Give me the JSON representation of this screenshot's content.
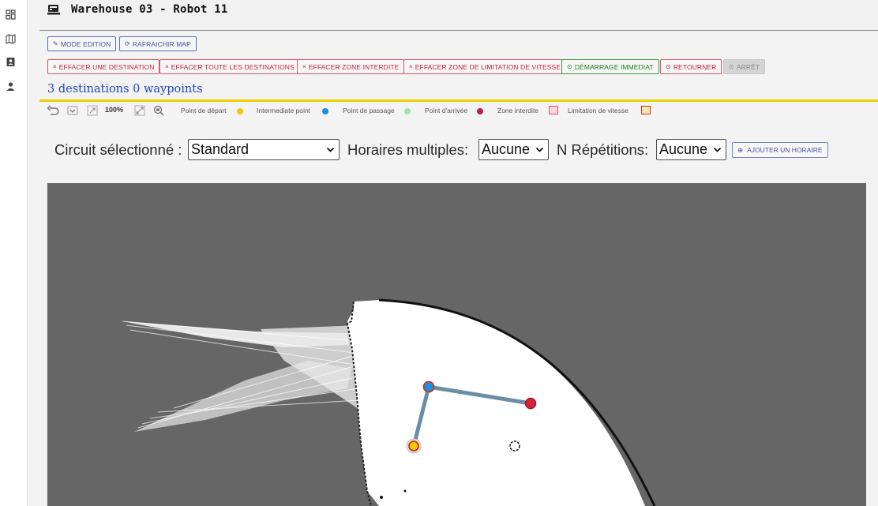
{
  "app": {
    "title": "Warehouse 03 - Robot 11"
  },
  "sidebar": {
    "items": [
      {
        "icon": "dashboard-icon"
      },
      {
        "icon": "map-icon"
      },
      {
        "icon": "contacts-icon"
      },
      {
        "icon": "user-icon"
      }
    ]
  },
  "actions": {
    "mode_edition": "MODE EDITION",
    "rafraichir_map": "RAFRAICHIR MAP",
    "effacer_destination": "EFFACER UNE DESTINATION",
    "effacer_toutes": "EFFACER TOUTE LES DESTINATIONS",
    "effacer_zone_interdite": "EFFACER ZONE INTERDITE",
    "effacer_zone_vitesse": "EFFACER ZONE DE LIMITATION DE VITESSE",
    "demarrage": "DÉMARRAGE IMMEDIAT",
    "retourner": "RETOURNER",
    "arret": "ARRÊT"
  },
  "summary": {
    "text": "3 destinations 0 waypoints"
  },
  "toolbar": {
    "zoom": "100%",
    "legend": [
      {
        "label": "Point de départ",
        "color": "#f5c800"
      },
      {
        "label": "Intermediate point",
        "color": "#1a8fe3"
      },
      {
        "label": "Point de passage",
        "color": "#9fe3b3"
      },
      {
        "label": "Point d'arrivée",
        "color": "#c2185b"
      },
      {
        "label": "Zone interdite",
        "color": "#d9546a"
      },
      {
        "label": "Limitation de vitesse",
        "color": "#d9a400"
      }
    ]
  },
  "controls": {
    "circuit_label": "Circuit sélectionné :",
    "circuit_value": "Standard",
    "horaires_label": "Horaires multiples:",
    "horaires_value": "Aucune",
    "repetitions_label": "N Répétitions:",
    "repetitions_value": "Aucune",
    "add_schedule": "AJOUTER UN HORAIRE"
  },
  "map": {
    "route_color": "#6a8ea6",
    "start_color": "#f5c800",
    "intermediate_color": "#1a8fe3",
    "end_color": "#d8233f"
  }
}
